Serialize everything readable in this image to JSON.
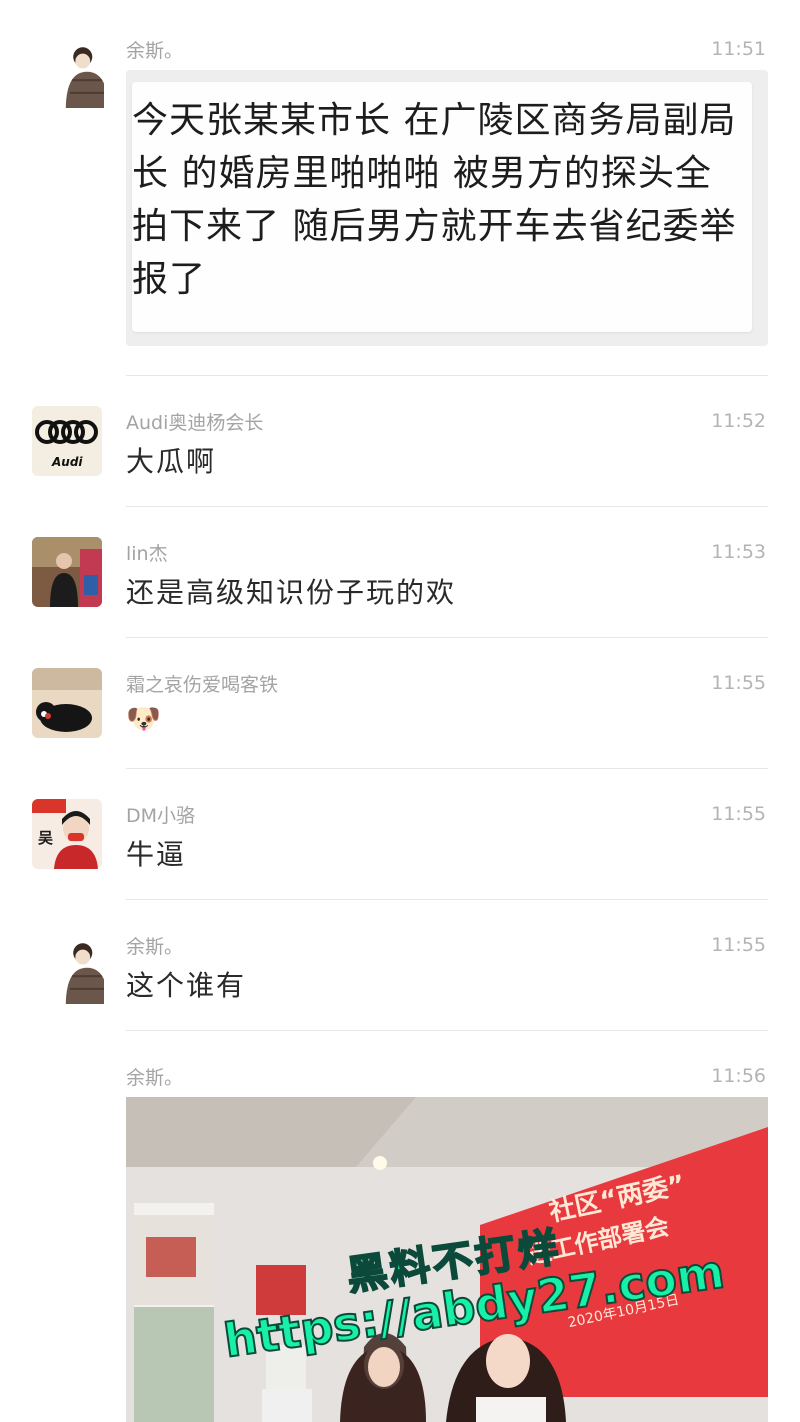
{
  "messages": [
    {
      "name": "余斯。",
      "time": "11:51",
      "quote": "今天张某某市长 在广陵区商务局副局长 的婚房里啪啪啪 被男方的探头全拍下来了 随后男方就开车去省纪委举报了"
    },
    {
      "name": "Audi奥迪杨会长",
      "time": "11:52",
      "text": "大瓜啊"
    },
    {
      "name": "lin杰",
      "time": "11:53",
      "text": "还是高级知识份子玩的欢"
    },
    {
      "name": "霜之哀伤爱喝客铁",
      "time": "11:55",
      "text": "🐶"
    },
    {
      "name": "DM小骆",
      "time": "11:55",
      "text": "牛逼"
    },
    {
      "name": "余斯。",
      "time": "11:55",
      "text": "这个谁有"
    },
    {
      "name": "余斯。",
      "time": "11:56"
    }
  ],
  "avatars": {
    "audi_text": "Audi",
    "dm_badge": "吴"
  },
  "photo": {
    "banner_line1": "社区“两委”",
    "banner_line2": "选工作部署会",
    "banner_date": "2020年10月15日",
    "watermark_line1": "黑料不打烊",
    "watermark_line2": "https://abdy27.com"
  },
  "colors": {
    "name_gray": "#a4a4a4",
    "banner_red": "#e8393f",
    "watermark_green": "#17f0a6"
  }
}
